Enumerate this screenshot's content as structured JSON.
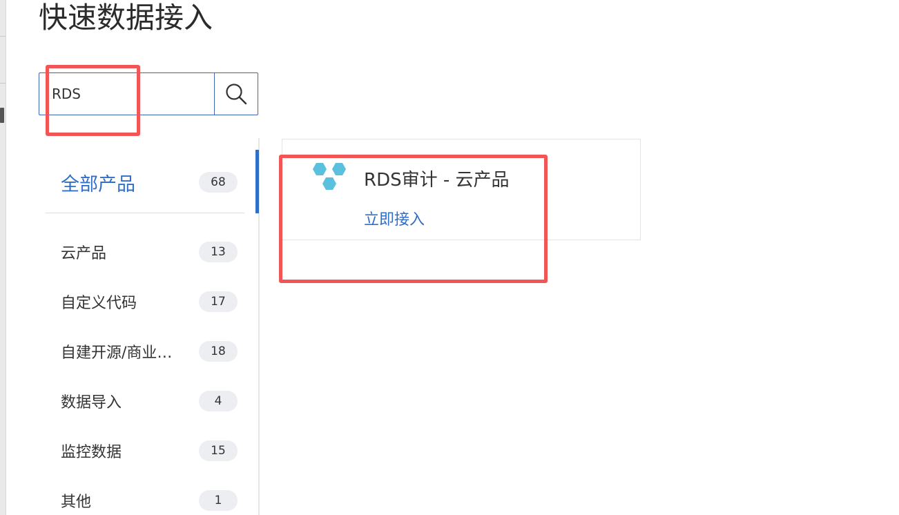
{
  "drawer": {
    "title": "快速数据接入"
  },
  "search": {
    "value": "RDS",
    "placeholder": ""
  },
  "categories": {
    "all": {
      "label": "全部产品",
      "count": "68"
    },
    "items": [
      {
        "label": "云产品",
        "count": "13"
      },
      {
        "label": "自定义代码",
        "count": "17"
      },
      {
        "label": "自建开源/商业…",
        "count": "18"
      },
      {
        "label": "数据导入",
        "count": "4"
      },
      {
        "label": "监控数据",
        "count": "15"
      },
      {
        "label": "其他",
        "count": "1"
      }
    ]
  },
  "results": [
    {
      "title": "RDS审计 - 云产品",
      "action": "立即接入",
      "icon": "hexagon-cluster-icon"
    }
  ],
  "colors": {
    "accent": "#2f6ec9",
    "highlight": "#f25555",
    "logo": "#5bbfde"
  }
}
